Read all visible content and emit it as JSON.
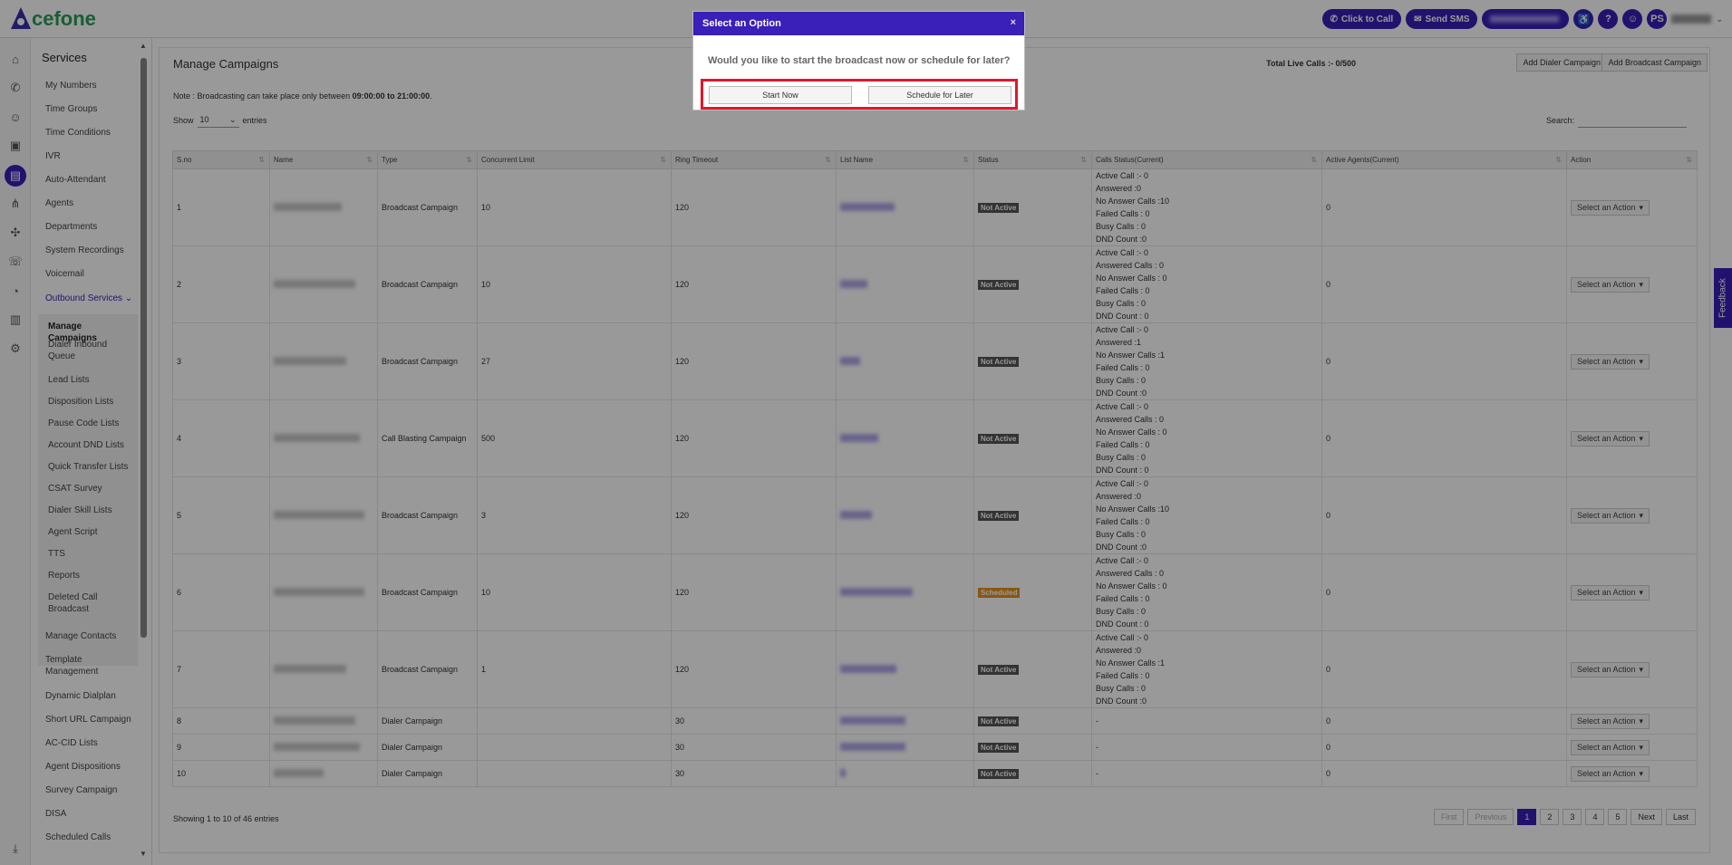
{
  "brand": {
    "logo_text": "cefone",
    "accent": "#3a1fb8",
    "logo_green": "#2a9c5a"
  },
  "top": {
    "click_to_call": "Click to Call",
    "send_sms": "Send SMS",
    "avatar": "PS"
  },
  "services": {
    "title": "Services",
    "items": [
      "My Numbers",
      "Time Groups",
      "Time Conditions",
      "IVR",
      "Auto-Attendant",
      "Agents",
      "Departments",
      "System Recordings",
      "Voicemail"
    ],
    "outbound": "Outbound Services",
    "sub_items": [
      "Manage Campaigns",
      "Dialer Inbound Queue",
      "Lead Lists",
      "Disposition Lists",
      "Pause Code Lists",
      "Account DND Lists",
      "Quick Transfer Lists",
      "CSAT Survey",
      "Dialer Skill Lists",
      "Agent Script",
      "TTS",
      "Reports",
      "Deleted Call Broadcast"
    ],
    "after_items": [
      "Manage Contacts",
      "Template Management",
      "Dynamic Dialplan",
      "Short URL Campaign",
      "AC-CID Lists",
      "Agent Dispositions",
      "Survey Campaign",
      "DISA",
      "Scheduled Calls"
    ]
  },
  "main": {
    "title": "Manage Campaigns",
    "live_calls": "Total Live Calls :- 0/500",
    "add_dialer": "Add Dialer Campaign",
    "add_broadcast": "Add Broadcast Campaign",
    "note_prefix": "Note : Broadcasting can take place only between ",
    "note_time": "09:00:00 to 21:00:00",
    "note_suffix": ".",
    "show_label": "Show",
    "show_value": "10",
    "entries_label": "entries",
    "search_label": "Search:",
    "columns": [
      "S.no",
      "Name",
      "Type",
      "Concurrent Limit",
      "Ring Timeout",
      "List Name",
      "Status",
      "Calls Status(Current)",
      "Active Agents(Current)",
      "Action"
    ],
    "rows": [
      {
        "sno": "1",
        "type": "Broadcast Campaign",
        "limit": "10",
        "ring": "120",
        "status": "Not Active",
        "calls": [
          "Active Call :- 0",
          "Answered :0",
          "No Answer Calls :10",
          "Failed Calls : 0",
          "Busy Calls : 0",
          "DND Count :0"
        ],
        "agents": "0",
        "action": "Select an Action"
      },
      {
        "sno": "2",
        "type": "Broadcast Campaign",
        "limit": "10",
        "ring": "120",
        "status": "Not Active",
        "calls": [
          "Active Call :- 0",
          "Answered Calls : 0",
          "No Answer Calls : 0",
          "Failed Calls : 0",
          "Busy Calls : 0",
          "DND Count : 0"
        ],
        "agents": "0",
        "action": "Select an Action"
      },
      {
        "sno": "3",
        "type": "Broadcast Campaign",
        "limit": "27",
        "ring": "120",
        "status": "Not Active",
        "calls": [
          "Active Call :- 0",
          "Answered :1",
          "No Answer Calls :1",
          "Failed Calls : 0",
          "Busy Calls : 0",
          "DND Count :0"
        ],
        "agents": "0",
        "action": "Select an Action"
      },
      {
        "sno": "4",
        "type": "Call Blasting Campaign",
        "limit": "500",
        "ring": "120",
        "status": "Not Active",
        "calls": [
          "Active Call :- 0",
          "Answered Calls : 0",
          "No Answer Calls : 0",
          "Failed Calls : 0",
          "Busy Calls : 0",
          "DND Count : 0"
        ],
        "agents": "0",
        "action": "Select an Action"
      },
      {
        "sno": "5",
        "type": "Broadcast Campaign",
        "limit": "3",
        "ring": "120",
        "status": "Not Active",
        "calls": [
          "Active Call :- 0",
          "Answered :0",
          "No Answer Calls :10",
          "Failed Calls : 0",
          "Busy Calls : 0",
          "DND Count :0"
        ],
        "agents": "0",
        "action": "Select an Action"
      },
      {
        "sno": "6",
        "type": "Broadcast Campaign",
        "limit": "10",
        "ring": "120",
        "status": "Scheduled",
        "calls": [
          "Active Call :- 0",
          "Answered Calls : 0",
          "No Answer Calls : 0",
          "Failed Calls : 0",
          "Busy Calls : 0",
          "DND Count : 0"
        ],
        "agents": "0",
        "action": "Select an Action"
      },
      {
        "sno": "7",
        "type": "Broadcast Campaign",
        "limit": "1",
        "ring": "120",
        "status": "Not Active",
        "calls": [
          "Active Call :- 0",
          "Answered :0",
          "No Answer Calls :1",
          "Failed Calls : 0",
          "Busy Calls : 0",
          "DND Count :0"
        ],
        "agents": "0",
        "action": "Select an Action"
      },
      {
        "sno": "8",
        "type": "Dialer Campaign",
        "limit": "",
        "ring": "30",
        "status": "Not Active",
        "calls": [
          "-"
        ],
        "agents": "0",
        "action": "Select an Action"
      },
      {
        "sno": "9",
        "type": "Dialer Campaign",
        "limit": "",
        "ring": "30",
        "status": "Not Active",
        "calls": [
          "-"
        ],
        "agents": "0",
        "action": "Select an Action"
      },
      {
        "sno": "10",
        "type": "Dialer Campaign",
        "limit": "",
        "ring": "30",
        "status": "Not Active",
        "calls": [
          "-"
        ],
        "agents": "0",
        "action": "Select an Action"
      }
    ],
    "showing": "Showing 1 to 10 of 46 entries",
    "pager": [
      "First",
      "Previous",
      "1",
      "2",
      "3",
      "4",
      "5",
      "Next",
      "Last"
    ]
  },
  "feedback": "Feedback",
  "modal": {
    "title": "Select an Option",
    "question": "Would you like to start the broadcast now or schedule for later?",
    "start_now": "Start Now",
    "schedule_later": "Schedule for Later",
    "close": "×"
  }
}
